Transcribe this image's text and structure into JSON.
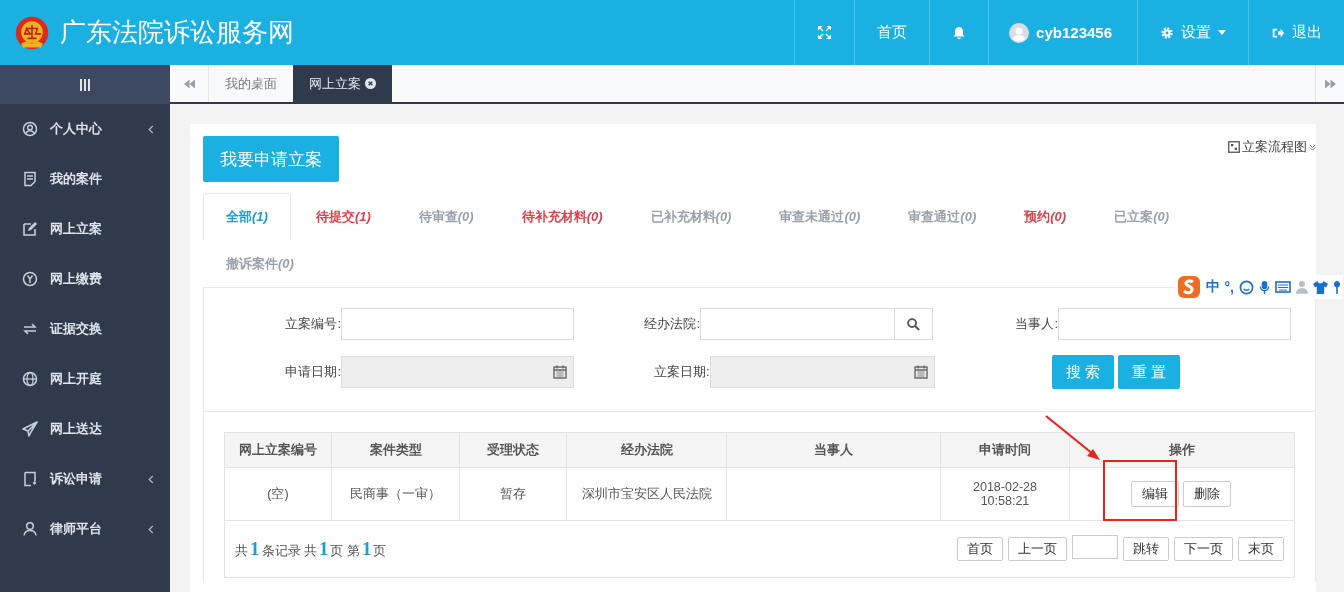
{
  "header": {
    "title": "广东法院诉讼服务网",
    "nav": [
      {
        "kind": "fullscreen"
      },
      {
        "kind": "text",
        "label": "首页"
      },
      {
        "kind": "bell"
      },
      {
        "kind": "user",
        "label": "cyb123456"
      },
      {
        "kind": "settings",
        "label": "设置"
      },
      {
        "kind": "logout",
        "label": "退出"
      }
    ]
  },
  "sidebar": {
    "items": [
      {
        "kind": "user",
        "label": "个人中心",
        "expandable": true
      },
      {
        "kind": "doc",
        "label": "我的案件",
        "expandable": false
      },
      {
        "kind": "edit",
        "label": "网上立案",
        "expandable": false
      },
      {
        "kind": "yuan",
        "label": "网上缴费",
        "expandable": false
      },
      {
        "kind": "swap",
        "label": "证据交换",
        "expandable": false
      },
      {
        "kind": "globe",
        "label": "网上开庭",
        "expandable": false
      },
      {
        "kind": "send",
        "label": "网上送达",
        "expandable": false
      },
      {
        "kind": "note",
        "label": "诉讼申请",
        "expandable": true
      },
      {
        "kind": "person",
        "label": "律师平台",
        "expandable": true
      }
    ]
  },
  "page_tabs": [
    {
      "label": "我的桌面",
      "selected": false,
      "closable": false
    },
    {
      "label": "网上立案",
      "selected": true,
      "closable": true
    }
  ],
  "apply_button": "我要申请立案",
  "flow_link": "立案流程图",
  "status_tabs": [
    {
      "label": "全部",
      "count": "(1)",
      "selected": true,
      "color": "#1a9fd0"
    },
    {
      "label": "待提交",
      "count": "(1)",
      "selected": false,
      "color": "#d9434e"
    },
    {
      "label": "待审查",
      "count": "(0)",
      "selected": false,
      "color": "#9aa1ab"
    },
    {
      "label": "待补充材料",
      "count": "(0)",
      "selected": false,
      "color": "#d9434e"
    },
    {
      "label": "已补充材料",
      "count": "(0)",
      "selected": false,
      "color": "#9aa1ab"
    },
    {
      "label": "审查未通过",
      "count": "(0)",
      "selected": false,
      "color": "#9aa1ab"
    },
    {
      "label": "审查通过",
      "count": "(0)",
      "selected": false,
      "color": "#9aa1ab"
    },
    {
      "label": "预约",
      "count": "(0)",
      "selected": false,
      "color": "#d9434e"
    },
    {
      "label": "已立案",
      "count": "(0)",
      "selected": false,
      "color": "#9aa1ab"
    },
    {
      "label": "撤诉案件",
      "count": "(0)",
      "selected": false,
      "color": "#9aa1ab"
    }
  ],
  "ime_toolbar": {
    "labels": [
      "中",
      "°,"
    ]
  },
  "filters": [
    {
      "label": "立案编号:",
      "kind": "text",
      "readonly": false
    },
    {
      "label": "经办法院:",
      "kind": "search",
      "readonly": false
    },
    {
      "label": "当事人:",
      "kind": "text",
      "readonly": false
    },
    {
      "label": "申请日期:",
      "kind": "date",
      "readonly": true
    },
    {
      "label": "立案日期:",
      "kind": "date",
      "readonly": true
    }
  ],
  "filter_buttons": [
    "搜 索",
    "重 置"
  ],
  "table": {
    "columns": [
      "网上立案编号",
      "案件类型",
      "受理状态",
      "经办法院",
      "当事人",
      "申请时间",
      "操作"
    ],
    "rows": [
      {
        "cells": [
          "(空)",
          "民商事（一审）",
          "暂存",
          "深圳市宝安区人民法院",
          "",
          [
            "2018-02-28",
            "10:58:21"
          ]
        ],
        "actions": [
          "编辑",
          "删除"
        ]
      }
    ]
  },
  "pager": {
    "summary": [
      "共",
      "1",
      "条记录 共",
      "1",
      "页 第",
      "1",
      "页"
    ],
    "buttons_before": [
      "首页",
      "上一页"
    ],
    "buttons_after": [
      "跳转",
      "下一页",
      "末页"
    ]
  },
  "annotation": {
    "highlight": true
  }
}
